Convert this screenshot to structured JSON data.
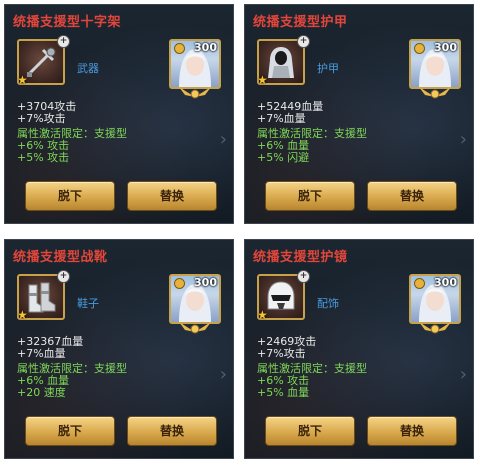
{
  "panels": [
    {
      "title": "统播支援型十字架",
      "slot_label": "武器",
      "char_level": "300",
      "stats": [
        "+3704攻击",
        "+7%攻击"
      ],
      "condition": "属性激活限定：支援型",
      "bonuses": [
        "+6% 攻击",
        "+5% 攻击"
      ],
      "item_icon": "cross-weapon-icon"
    },
    {
      "title": "统播支援型护甲",
      "slot_label": "护甲",
      "char_level": "300",
      "stats": [
        "+52449血量",
        "+7%血量"
      ],
      "condition": "属性激活限定：支援型",
      "bonuses": [
        "+6% 血量",
        "+5% 闪避"
      ],
      "item_icon": "hooded-armor-icon"
    },
    {
      "title": "统播支援型战靴",
      "slot_label": "鞋子",
      "char_level": "300",
      "stats": [
        "+32367血量",
        "+7%血量"
      ],
      "condition": "属性激活限定：支援型",
      "bonuses": [
        "+6% 血量",
        "+20 速度"
      ],
      "item_icon": "boots-icon"
    },
    {
      "title": "统播支援型护镜",
      "slot_label": "配饰",
      "char_level": "300",
      "stats": [
        "+2469攻击",
        "+7%攻击"
      ],
      "condition": "属性激活限定：支援型",
      "bonuses": [
        "+6% 攻击",
        "+5% 血量"
      ],
      "item_icon": "helmet-accessory-icon"
    }
  ],
  "buttons": {
    "unequip": "脱下",
    "replace": "替换"
  },
  "colors": {
    "title": "#e2463a",
    "slot": "#4a9be0",
    "bonus": "#7fd858",
    "button": "#d9a94d"
  }
}
